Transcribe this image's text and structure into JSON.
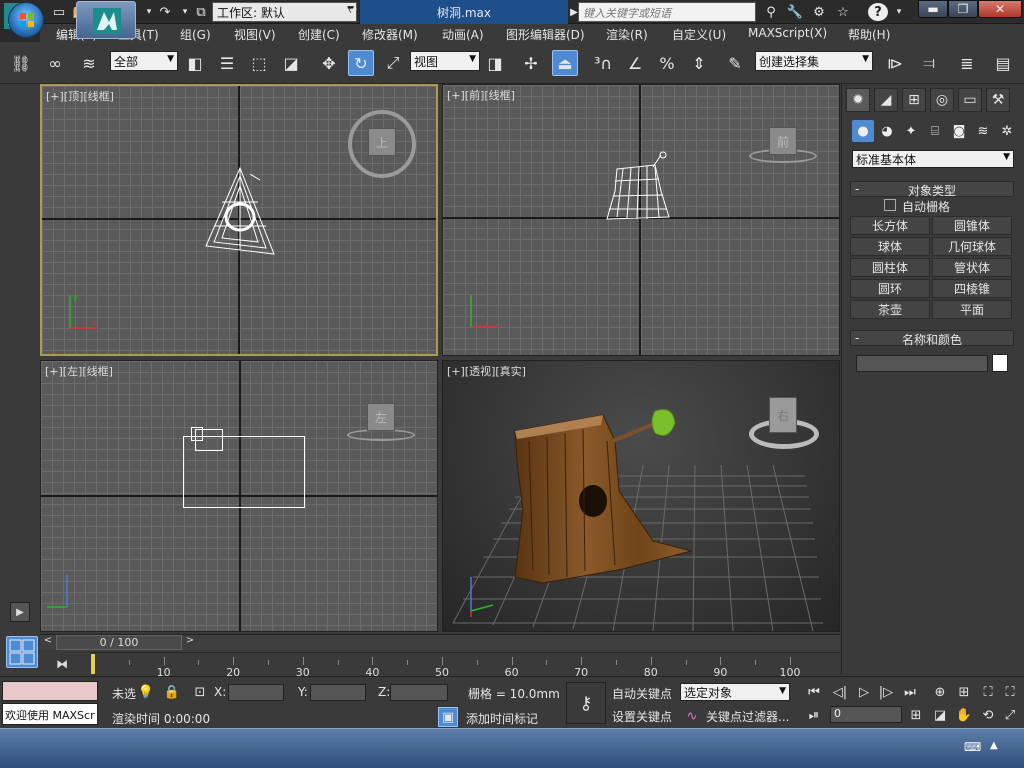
{
  "titlebar": {
    "workspace_label": "工作区: 默认",
    "document_title": "树洞.max",
    "search_placeholder": "键入关键字或短语"
  },
  "menu": {
    "items": [
      "编辑(E)",
      "工具(T)",
      "组(G)",
      "视图(V)",
      "创建(C)",
      "修改器(M)",
      "动画(A)",
      "图形编辑器(D)",
      "渲染(R)",
      "自定义(U)",
      "MAXScript(X)",
      "帮助(H)"
    ]
  },
  "toolbar": {
    "selection_filter": "全部",
    "reference_coord": "视图",
    "named_selection": "创建选择集"
  },
  "viewports": {
    "top": {
      "label": "[+][顶][线框]",
      "cube": "上"
    },
    "front": {
      "label": "[+][前][线框]",
      "cube": "前"
    },
    "left": {
      "label": "[+][左][线框]",
      "cube": "左"
    },
    "perspective": {
      "label": "[+][透视][真实]",
      "cube": "右"
    }
  },
  "command_panel": {
    "primitive_type": "标准基本体",
    "object_type_title": "对象类型",
    "autogrid_label": "自动栅格",
    "buttons": [
      "长方体",
      "圆锥体",
      "球体",
      "几何球体",
      "圆柱体",
      "管状体",
      "圆环",
      "四棱锥",
      "茶壶",
      "平面"
    ],
    "name_color_title": "名称和颜色"
  },
  "timeline": {
    "frame_readout": "0 / 100",
    "ticks": [
      10,
      20,
      30,
      40,
      50,
      60,
      70,
      80,
      90,
      100
    ]
  },
  "statusbar": {
    "maxscript_text": "欢迎使用 MAXScr",
    "selection_status": "未选",
    "x_label": "X:",
    "y_label": "Y:",
    "z_label": "Z:",
    "grid_text": "栅格 = 10.0mm",
    "render_time": "渲染时间  0:00:00",
    "add_time_tag": "添加时间标记",
    "auto_key": "自动关键点",
    "set_key": "设置关键点",
    "key_mode_select": "选定对象",
    "key_filters": "关键点过滤器...",
    "current_frame": "0"
  }
}
